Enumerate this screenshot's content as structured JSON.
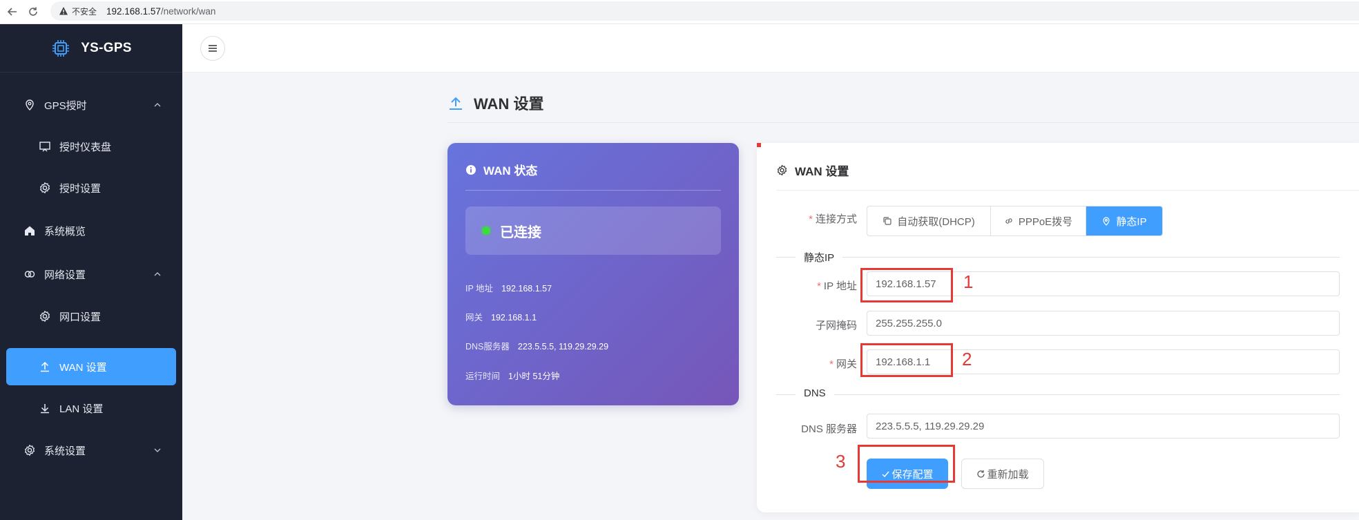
{
  "browser": {
    "insecure_label": "不安全",
    "url_host": "192.168.1.57",
    "url_path": "/network/wan"
  },
  "sidebar": {
    "logo_text": "YS-GPS",
    "items": [
      {
        "label": "GPS授时",
        "icon": "location-pin-icon"
      },
      {
        "label": "授时仪表盘",
        "icon": "monitor-icon"
      },
      {
        "label": "授时设置",
        "icon": "gear-icon"
      },
      {
        "label": "系统概览",
        "icon": "home-icon"
      },
      {
        "label": "网络设置",
        "icon": "link-icon"
      },
      {
        "label": "网口设置",
        "icon": "gear-icon"
      },
      {
        "label": "WAN 设置",
        "icon": "upload-icon"
      },
      {
        "label": "LAN 设置",
        "icon": "download-icon"
      },
      {
        "label": "系统设置",
        "icon": "gear-icon"
      }
    ]
  },
  "page": {
    "title": "WAN 设置"
  },
  "status_card": {
    "title": "WAN 状态",
    "connection": "已连接",
    "ip_label": "IP 地址",
    "ip_value": "192.168.1.57",
    "gateway_label": "网关",
    "gateway_value": "192.168.1.1",
    "dns_label": "DNS服务器",
    "dns_value": "223.5.5.5, 119.29.29.29",
    "uptime_label": "运行时间",
    "uptime_value": "1小时 51分钟"
  },
  "settings_card": {
    "title": "WAN 设置",
    "mode_label": "连接方式",
    "modes": [
      {
        "label": "自动获取(DHCP)",
        "icon": "copy-icon"
      },
      {
        "label": "PPPoE拨号",
        "icon": "link-icon"
      },
      {
        "label": "静态IP",
        "icon": "location-pin-icon"
      }
    ],
    "selected_mode": "静态IP",
    "static_section": "静态IP",
    "ip_label": "IP 地址",
    "ip_value": "192.168.1.57",
    "mask_label": "子网掩码",
    "mask_value": "255.255.255.0",
    "gateway_label": "网关",
    "gateway_value": "192.168.1.1",
    "dns_section": "DNS",
    "dns_label": "DNS 服务器",
    "dns_value": "223.5.5.5, 119.29.29.29",
    "save_label": "保存配置",
    "reload_label": "重新加载"
  },
  "annotations": [
    "1",
    "2",
    "3"
  ],
  "colors": {
    "accent": "#409eff",
    "sidebar_bg": "#1d2233",
    "annotation": "#e53935",
    "status_gradient_start": "#6774dd",
    "status_gradient_end": "#7656b8"
  }
}
